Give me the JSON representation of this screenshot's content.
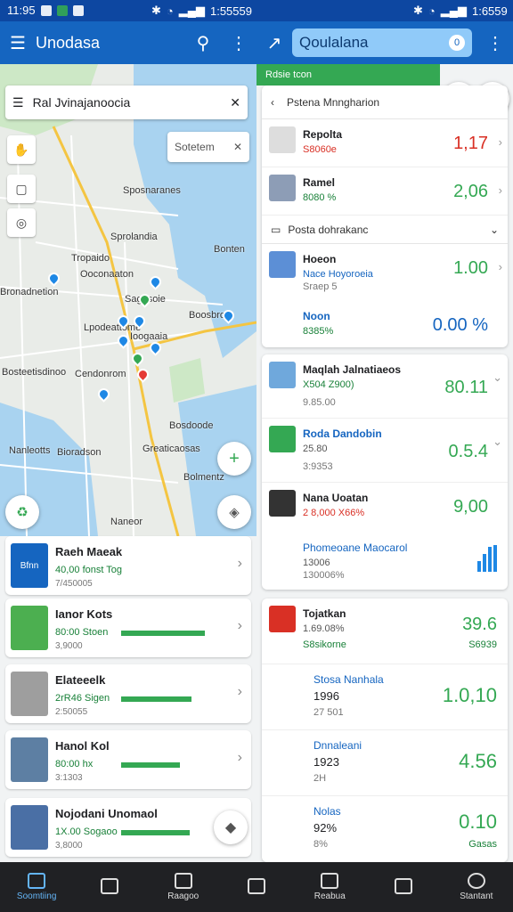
{
  "status": {
    "left_time": "11:95",
    "right_time": "1:55559",
    "right2_time": "1:6559"
  },
  "left_app": {
    "title": "Unodasa"
  },
  "right_app": {
    "search": "Qoulalana",
    "badge": "0"
  },
  "map": {
    "search_text": "Ral Jvinajanoocia",
    "mini_search": "Sotetem",
    "labels": [
      "Sposnaranes",
      "Sprolandia",
      "Tropaido",
      "Bonten",
      "Bronadnetion",
      "Sagasoie",
      "Lpodeattome",
      "Ioogaaia",
      "Bosteetisdinoo",
      "Cendonrom",
      "Bosdoode",
      "Naneor",
      "Greaticaosas",
      "Bioradson",
      "Nanleotts",
      "Bolmentz",
      "Ooconaaton",
      "Boosbrolo"
    ]
  },
  "left_list": [
    {
      "title": "Raeh Maeak",
      "sub": "40,00 fonst Tog",
      "meta": "7/450005",
      "color": "#1565c0",
      "thumb_text": "Bfnn",
      "progress": 0
    },
    {
      "title": "Ianor Kots",
      "sub": "80:00 Stoen",
      "meta": "3,9000",
      "color": "#4caf50",
      "thumb_text": "",
      "progress": 0.85
    },
    {
      "title": "Elateeelk",
      "sub": "2rR46 Sigen",
      "meta": "2:50055",
      "color": "#9e9e9e",
      "thumb_text": "",
      "progress": 0.72
    },
    {
      "title": "Hanol Kol",
      "sub": "80:00 hx",
      "meta": "3:1303",
      "color": "#5d7fa3",
      "thumb_text": "",
      "progress": 0.6
    },
    {
      "title": "Nojodani Unomaol",
      "sub": "1X.00 Sogaoo",
      "meta": "3,8000",
      "color": "#4a6fa5",
      "thumb_text": "",
      "progress": 0.7
    }
  ],
  "right_tab": {
    "label": "Rdsie tcon"
  },
  "right_panel1": {
    "header": "Pstena Mnngharion",
    "rows": [
      {
        "name": "Repolta",
        "sub": "S8060e",
        "value": "1,17",
        "value_color": "#d93025"
      },
      {
        "name": "Ramel",
        "sub": "8080 %",
        "value": "2,06",
        "value_color": "#34a853"
      }
    ],
    "section": "Posta dohrakanc",
    "row3": {
      "name": "Hoeon",
      "sub": "Nace Hoyoroeia",
      "sub2": "Sraep 5",
      "value": "1.00"
    },
    "row4": {
      "name": "Noon",
      "sub": "8385%",
      "value": "0.00 %"
    }
  },
  "right_panel2": [
    {
      "name": "Maqlah Jalnatiaeos",
      "sub": "X504 Z900)",
      "meta": "9.85.00",
      "value": "80.11"
    },
    {
      "name": "Roda Dandobin",
      "sub": "25.80",
      "meta": "3:9353",
      "value": "0.5.4"
    },
    {
      "name": "Nana Uoatan",
      "sub": "2 8,000 X66%",
      "meta": "",
      "value": "9,00"
    },
    {
      "name": "Phomeoane Maocarol",
      "sub": "13006",
      "meta": "130006%",
      "value": ""
    }
  ],
  "right_panel3": [
    {
      "name": "Tojatkan",
      "sub": "1.69.08%",
      "meta": "S8sikorne",
      "value": "39.6",
      "value2": "S6939"
    },
    {
      "name": "Stosa Nanhala",
      "sub": "1996",
      "meta": "27 501",
      "value": "1.0,10"
    },
    {
      "name": "Dnnaleani",
      "sub": "1923",
      "meta": "2H",
      "value": "4.56"
    },
    {
      "name": "Nolas",
      "sub": "92%",
      "meta": "8%",
      "value": "0.10",
      "value2": "Gasas"
    }
  ],
  "bottom_nav": [
    {
      "label": "Soomtiing",
      "active": true
    },
    {
      "label": "",
      "active": false
    },
    {
      "label": "Raagoo",
      "active": false
    },
    {
      "label": "",
      "active": false
    },
    {
      "label": "Reabua",
      "active": false
    },
    {
      "label": "",
      "active": false
    },
    {
      "label": "Stantant",
      "active": false
    }
  ]
}
